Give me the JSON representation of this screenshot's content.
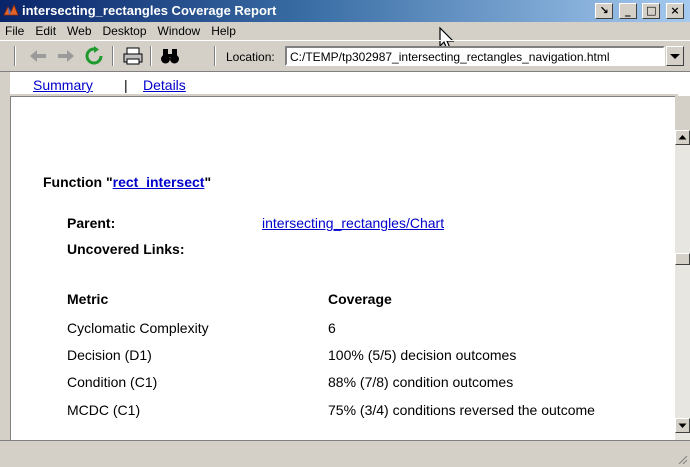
{
  "window": {
    "title": "intersecting_rectangles Coverage Report"
  },
  "menu": [
    "File",
    "Edit",
    "Web",
    "Desktop",
    "Window",
    "Help"
  ],
  "toolbar": {
    "location_label": "Location:",
    "location_value": "C:/TEMP/tp302987_intersecting_rectangles_navigation.html"
  },
  "tabs": {
    "summary": "Summary",
    "separator": "|",
    "details": "Details"
  },
  "function": {
    "prefix": "Function \"",
    "name": "rect_intersect",
    "suffix": "\""
  },
  "parent": {
    "label": "Parent:",
    "link": "intersecting_rectangles/Chart"
  },
  "uncovered": {
    "label": "Uncovered Links:"
  },
  "metrics": {
    "header_metric": "Metric",
    "header_coverage": "Coverage",
    "rows": [
      {
        "metric": "Cyclomatic Complexity",
        "coverage": "6"
      },
      {
        "metric": "Decision (D1)",
        "coverage": "100% (5/5) decision outcomes"
      },
      {
        "metric": "Condition (C1)",
        "coverage": "88% (7/8) condition outcomes"
      },
      {
        "metric": "MCDC (C1)",
        "coverage": "75% (3/4) conditions reversed the outcome"
      }
    ]
  },
  "colors": {
    "title_start": "#0a246a",
    "title_end": "#a6caf0",
    "link": "#0000cc",
    "chrome": "#d4d0c8"
  }
}
